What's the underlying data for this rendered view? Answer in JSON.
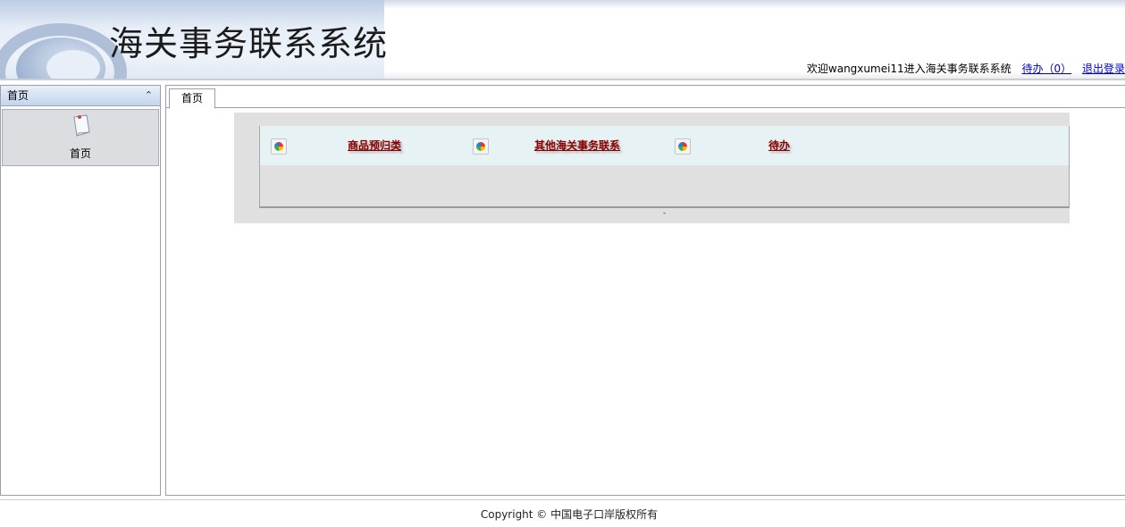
{
  "header": {
    "app_title": "海关事务联系系统",
    "welcome_text": "欢迎wangxumei11进入海关事务联系系统",
    "todo_link": "待办（0）",
    "logout_link": "退出登录"
  },
  "sidebar": {
    "title": "首页",
    "collapse_icon": "double-chevron-up-icon",
    "items": [
      {
        "label": "首页",
        "icon": "document-icon"
      }
    ]
  },
  "main": {
    "tabs": [
      {
        "label": "首页"
      }
    ],
    "quick_links": [
      {
        "label": "商品预归类",
        "icon": "color-ball-icon"
      },
      {
        "label": "其他海关事务联系",
        "icon": "color-ball-icon"
      },
      {
        "label": "待办",
        "icon": "color-ball-icon"
      }
    ],
    "pager_text": "-"
  },
  "footer": {
    "copyright": "Copyright © 中国电子口岸版权所有"
  },
  "colors": {
    "link_red": "#8b0000",
    "link_blue": "#0000cc",
    "panel_grey": "#e0e0e0",
    "quick_row_bg": "#e6f2f4"
  }
}
